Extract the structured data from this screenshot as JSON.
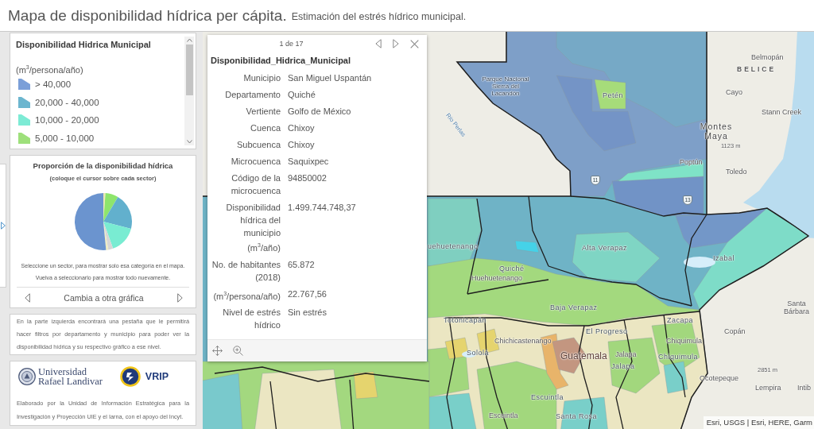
{
  "header": {
    "title": "Mapa de disponibilidad hídrica per cápita.",
    "subtitle": "Estimación del estrés hídrico municipal."
  },
  "legend": {
    "title": "Disponibilidad Hidrica Municipal",
    "unit": "(m$^{3}$/persona/año)",
    "items": [
      {
        "label": "> 40,000",
        "color": "#7b9fd8"
      },
      {
        "label": "20,000 - 40,000",
        "color": "#6cb6cf"
      },
      {
        "label": "10,000 - 20,000",
        "color": "#7debd5"
      },
      {
        "label": "5,000 - 10,000",
        "color": "#9ee07b"
      }
    ]
  },
  "chart_panel": {
    "title": "Proporción de la disponibilidad hídrica",
    "subtitle": "(coloque el cursor sobre cada sector)",
    "notes": [
      "Seleccione un sector, para mostrar solo esa categoría en el mapa.",
      "Vuelva a seleccionarlo para mostrar todo nuevamente."
    ],
    "switch_label": "Cambia a otra gráfica"
  },
  "info_text": "En la parte izquierda encontrará una pestaña que le permitirá hacer filtros por departamento y municipio para poder ver la disponibilidad hídrica y su respectivo gráfico a ese nivel.",
  "credits": {
    "logos": [
      {
        "kind": "seal",
        "lines": [
          "Universidad",
          "Rafael Landivar"
        ]
      },
      {
        "kind": "badge",
        "lines": [
          "VRIP"
        ]
      }
    ],
    "text": "Elaborado por la Unidad de Información Estratégica para la Investigación y Proyección UIE y el Iarna, con el apoyo del Incyt."
  },
  "popup": {
    "counter": "1 de 17",
    "title": "Disponibilidad_Hidrica_Municipal",
    "fields": [
      {
        "label": "Municipio",
        "value": "San Miguel Uspantán"
      },
      {
        "label": "Departamento",
        "value": "Quiché"
      },
      {
        "label": "Vertiente",
        "value": "Golfo de México"
      },
      {
        "label": "Cuenca",
        "value": "Chixoy"
      },
      {
        "label": "Subcuenca",
        "value": "Chixoy"
      },
      {
        "label": "Microcuenca",
        "value": "Saquixpec"
      },
      {
        "label": "Código de la microcuenca",
        "value": "94850002"
      },
      {
        "label": "Disponibilidad hídrica del municipio (m$^{3}$/año)",
        "value": "1.499.744.748,37"
      },
      {
        "label": "No. de habitantes (2018)",
        "value": "65.872"
      },
      {
        "label": "(m$^{3}$/persona/año)",
        "value": "22.767,56"
      },
      {
        "label": "Nivel de estrés hídrico",
        "value": "Sin estrés"
      }
    ]
  },
  "map": {
    "labels": [
      {
        "text": "Belmopán",
        "kind": "city"
      },
      {
        "text": "BELICE",
        "kind": "country"
      },
      {
        "text": "Parque Nacional Sierra del Lacandón",
        "kind": "park"
      },
      {
        "text": "Petén",
        "kind": "department"
      },
      {
        "text": "Cayo",
        "kind": "city"
      },
      {
        "text": "Río Perlas",
        "kind": "river"
      },
      {
        "text": "Stann Creek",
        "kind": "city"
      },
      {
        "text": "Montes Maya",
        "kind": "range"
      },
      {
        "text": "1123 m",
        "kind": "elevation"
      },
      {
        "text": "Poptún",
        "kind": "city"
      },
      {
        "text": "Toledo",
        "kind": "city"
      },
      {
        "text": "uehuetenango",
        "kind": "department"
      },
      {
        "text": "Alta Verapaz",
        "kind": "department"
      },
      {
        "text": "Izabal",
        "kind": "department"
      },
      {
        "text": "Quiché",
        "kind": "department"
      },
      {
        "text": "Huehuetenango",
        "kind": "city"
      },
      {
        "text": "Baja Verapaz",
        "kind": "department"
      },
      {
        "text": "Santa Bárbara",
        "kind": "city"
      },
      {
        "text": "Totonicapán",
        "kind": "department"
      },
      {
        "text": "Zacapa",
        "kind": "department"
      },
      {
        "text": "El Progreso",
        "kind": "department"
      },
      {
        "text": "Copán",
        "kind": "city"
      },
      {
        "text": "Chichicastenango",
        "kind": "city"
      },
      {
        "text": "Chiquimula",
        "kind": "city"
      },
      {
        "text": "Sololá",
        "kind": "department"
      },
      {
        "text": "Guatemala",
        "kind": "capital"
      },
      {
        "text": "Jalapa",
        "kind": "city"
      },
      {
        "text": "Chiquimula",
        "kind": "department"
      },
      {
        "text": "Jalapa",
        "kind": "department"
      },
      {
        "text": "2851 m",
        "kind": "elevation"
      },
      {
        "text": "Ocotepeque",
        "kind": "city"
      },
      {
        "text": "Lempira",
        "kind": "city"
      },
      {
        "text": "Intib",
        "kind": "city"
      },
      {
        "text": "Escuintla",
        "kind": "department"
      },
      {
        "text": "Escuintla",
        "kind": "city"
      },
      {
        "text": "Santa Rosa",
        "kind": "department"
      }
    ],
    "route_shields": [
      "11",
      "13"
    ],
    "attribution": "Esri, USGS | Esri, HERE, Garm"
  }
}
